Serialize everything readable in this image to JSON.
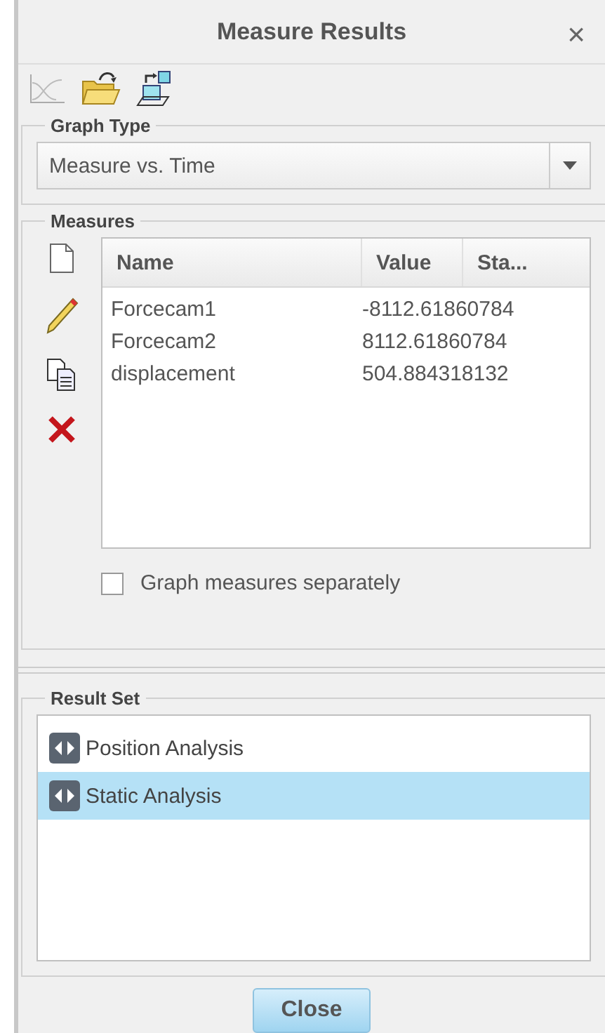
{
  "window": {
    "title": "Measure Results",
    "close": "×"
  },
  "graph_type": {
    "label": "Graph Type",
    "value": "Measure vs. Time"
  },
  "measures": {
    "label": "Measures",
    "columns": [
      "Name",
      "Value",
      "Sta..."
    ],
    "rows": [
      {
        "name": "Forcecam1",
        "value": "-8112.61860784"
      },
      {
        "name": "Forcecam2",
        "value": "8112.61860784"
      },
      {
        "name": "displacement",
        "value": "504.884318132"
      }
    ],
    "separate": {
      "label": "Graph measures separately",
      "checked": false
    }
  },
  "result_set": {
    "label": "Result Set",
    "items": [
      {
        "label": "Position Analysis",
        "selected": false
      },
      {
        "label": "Static Analysis",
        "selected": true
      }
    ]
  },
  "buttons": [
    "Close"
  ]
}
